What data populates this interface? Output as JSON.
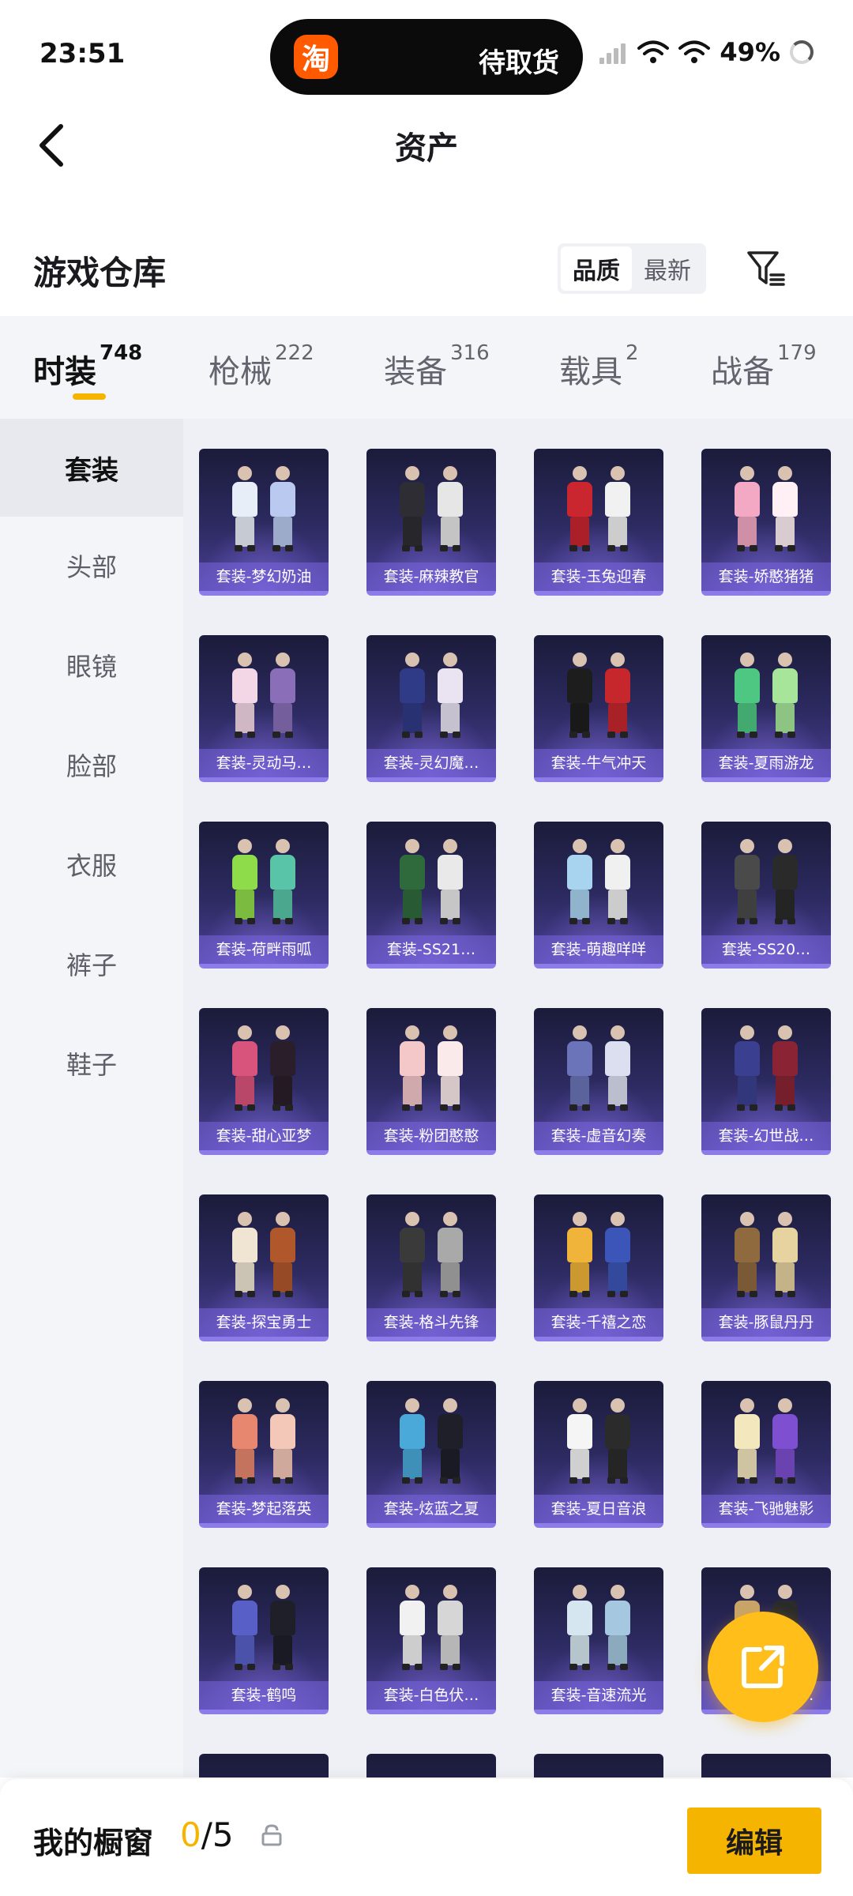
{
  "status_bar": {
    "time": "23:51",
    "island_app_glyph": "淘",
    "island_text": "待取货",
    "battery": "49%"
  },
  "header": {
    "title": "资产"
  },
  "warehouse": {
    "title": "游戏仓库",
    "sort_options": [
      "品质",
      "最新"
    ],
    "sort_selected": "品质"
  },
  "tabs": [
    {
      "label": "时装",
      "count": "748",
      "active": true
    },
    {
      "label": "枪械",
      "count": "222",
      "active": false
    },
    {
      "label": "装备",
      "count": "316",
      "active": false
    },
    {
      "label": "载具",
      "count": "2",
      "active": false
    },
    {
      "label": "战备",
      "count": "179",
      "active": false
    }
  ],
  "side_menu": [
    {
      "label": "套装",
      "active": true
    },
    {
      "label": "头部",
      "active": false
    },
    {
      "label": "眼镜",
      "active": false
    },
    {
      "label": "脸部",
      "active": false
    },
    {
      "label": "衣服",
      "active": false
    },
    {
      "label": "裤子",
      "active": false
    },
    {
      "label": "鞋子",
      "active": false
    }
  ],
  "items": [
    {
      "name": "套装-梦幻奶油",
      "colors": [
        "#e8eef8",
        "#b9c9ef"
      ]
    },
    {
      "name": "套装-麻辣教官",
      "colors": [
        "#2d2d33",
        "#e6e6e6"
      ]
    },
    {
      "name": "套装-玉兔迎春",
      "colors": [
        "#c9262f",
        "#f1f1f1"
      ]
    },
    {
      "name": "套装-娇憨猪猪",
      "colors": [
        "#f3a9c4",
        "#fff0f5"
      ]
    },
    {
      "name": "套装-灵动马…",
      "colors": [
        "#f4d7e6",
        "#8a6fb8"
      ]
    },
    {
      "name": "套装-灵幻魔…",
      "colors": [
        "#2f3b86",
        "#e9e3f2"
      ]
    },
    {
      "name": "套装-牛气冲天",
      "colors": [
        "#1d1d1d",
        "#c5272d"
      ]
    },
    {
      "name": "套装-夏雨游龙",
      "colors": [
        "#4ec783",
        "#a6e59a"
      ]
    },
    {
      "name": "套装-荷畔雨呱",
      "colors": [
        "#8fdc4b",
        "#59c4a8"
      ]
    },
    {
      "name": "套装-SS21…",
      "colors": [
        "#2f6a3c",
        "#e9e9e9"
      ]
    },
    {
      "name": "套装-萌趣咩咩",
      "colors": [
        "#a9d4f0",
        "#f0f0f0"
      ]
    },
    {
      "name": "套装-SS20…",
      "colors": [
        "#4a4a4a",
        "#2a2a2a"
      ]
    },
    {
      "name": "套装-甜心亚梦",
      "colors": [
        "#d9547c",
        "#2a1e2a"
      ]
    },
    {
      "name": "套装-粉团憨憨",
      "colors": [
        "#f4c7c9",
        "#fbeaea"
      ]
    },
    {
      "name": "套装-虚音幻奏",
      "colors": [
        "#6b74b8",
        "#dcdff0"
      ]
    },
    {
      "name": "套装-幻世战…",
      "colors": [
        "#3b3f8f",
        "#8a2334"
      ]
    },
    {
      "name": "套装-探宝勇士",
      "colors": [
        "#efe5d2",
        "#b0572c"
      ]
    },
    {
      "name": "套装-格斗先锋",
      "colors": [
        "#3a3a3a",
        "#a9a9a9"
      ]
    },
    {
      "name": "套装-千禧之恋",
      "colors": [
        "#f0b43a",
        "#3b56b8"
      ]
    },
    {
      "name": "套装-豚鼠丹丹",
      "colors": [
        "#8f6a3f",
        "#e7d3a0"
      ]
    },
    {
      "name": "套装-梦起落英",
      "colors": [
        "#e7876f",
        "#f3c8b8"
      ]
    },
    {
      "name": "套装-炫蓝之夏",
      "colors": [
        "#4aa9d8",
        "#1f1f2a"
      ]
    },
    {
      "name": "套装-夏日音浪",
      "colors": [
        "#f5f5f5",
        "#2b2b2b"
      ]
    },
    {
      "name": "套装-飞驰魅影",
      "colors": [
        "#f2e7bd",
        "#7e4fd0"
      ]
    },
    {
      "name": "套装-鹤鸣",
      "colors": [
        "#5860c8",
        "#1f1f2a"
      ]
    },
    {
      "name": "套装-白色伏…",
      "colors": [
        "#f1f1f1",
        "#d6d6d6"
      ]
    },
    {
      "name": "套装-音速流光",
      "colors": [
        "#d6e6f0",
        "#a5c8e0"
      ]
    },
    {
      "name": "套装-黑色伏…",
      "colors": [
        "#c8a469",
        "#2b2b2b"
      ]
    }
  ],
  "bottom_bar": {
    "title": "我的橱窗",
    "count_current": "0",
    "count_total": "/5",
    "edit_label": "编辑"
  }
}
